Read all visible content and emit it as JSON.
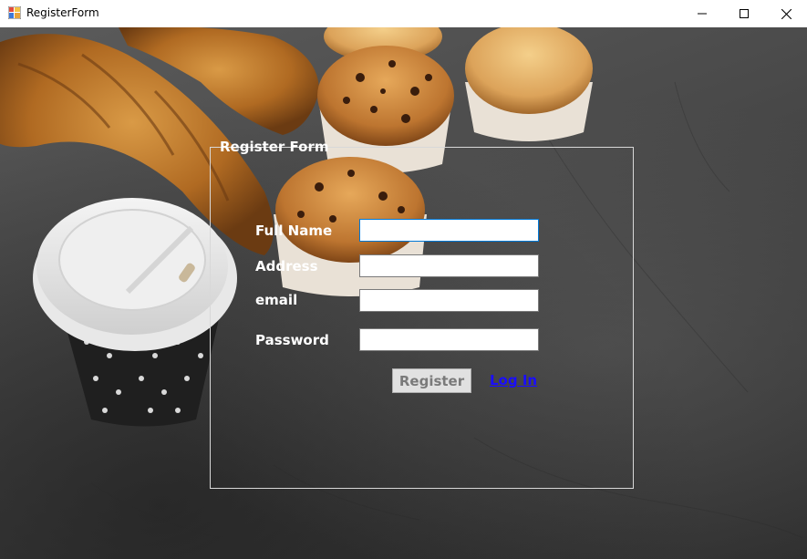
{
  "window": {
    "title": "RegisterForm",
    "icon": "winforms-app-icon"
  },
  "form": {
    "group_title": "Register Form",
    "fields": [
      {
        "label": "Full Name",
        "value": ""
      },
      {
        "label": "Address",
        "value": ""
      },
      {
        "label": "email",
        "value": ""
      },
      {
        "label": "Password",
        "value": ""
      }
    ],
    "register_label": "Register",
    "login_label": "Log In"
  },
  "colors": {
    "link": "#1a0dff",
    "focus_border": "#0078d7",
    "group_border": "#d8d8d8"
  }
}
